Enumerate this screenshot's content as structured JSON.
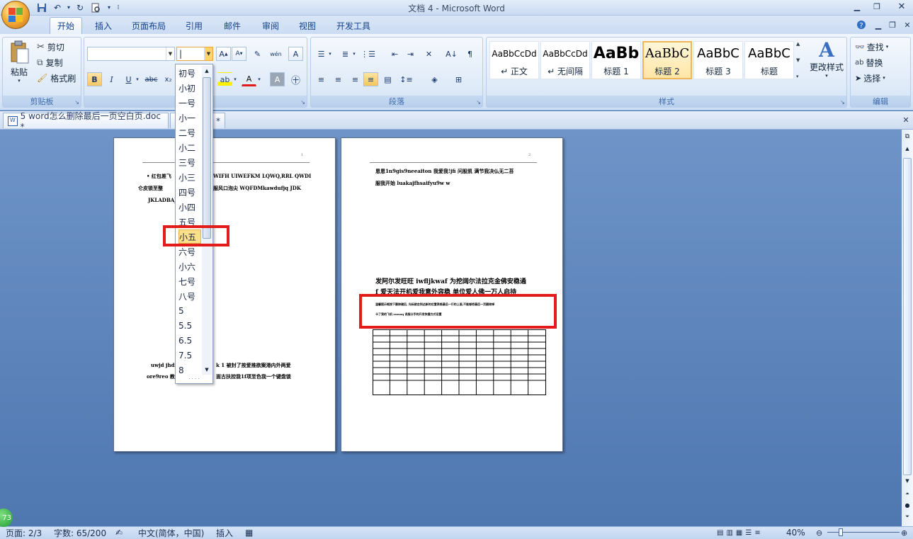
{
  "window": {
    "title": "文档 4 - Microsoft Word"
  },
  "quick_access": {
    "icons": [
      "save-icon",
      "undo-icon",
      "redo-icon",
      "print-preview-icon",
      "customize-icon"
    ]
  },
  "tabs": [
    "开始",
    "插入",
    "页面布局",
    "引用",
    "邮件",
    "审阅",
    "视图",
    "开发工具"
  ],
  "clipboard": {
    "paste": "粘贴",
    "cut": "剪切",
    "copy": "复制",
    "format_painter": "格式刷",
    "label": "剪贴板"
  },
  "font": {
    "font_name": "",
    "font_size": "|",
    "label": "字体"
  },
  "paragraph": {
    "label": "段落"
  },
  "styles": {
    "items": [
      {
        "preview": "AaBbCcDd",
        "name": "↵ 正文"
      },
      {
        "preview": "AaBbCcDd",
        "name": "↵ 无间隔"
      },
      {
        "preview": "AaBb",
        "name": "标题 1"
      },
      {
        "preview": "AaBbC",
        "name": "标题 2"
      },
      {
        "preview": "AaBbC",
        "name": "标题 3"
      },
      {
        "preview": "AaBbC",
        "name": "标题"
      }
    ],
    "change_styles": "更改样式",
    "label": "样式"
  },
  "editing": {
    "find": "查找",
    "replace": "替换",
    "select": "选择",
    "label": "编辑"
  },
  "doc_tabs": [
    {
      "label": "5 word怎么删除最后一页空白页.doc *"
    },
    {
      "label": "*"
    }
  ],
  "font_size_dropdown": {
    "options": [
      "初号",
      "小初",
      "一号",
      "小一",
      "二号",
      "小二",
      "三号",
      "小三",
      "四号",
      "小四",
      "五号",
      "小五",
      "六号",
      "小六",
      "七号",
      "八号",
      "5",
      "5.5",
      "6.5",
      "7.5",
      "8"
    ],
    "highlighted": "小五"
  },
  "page1": {
    "header_num": "1",
    "lines": [
      "• 红包差飞",
      "WIFH UIWEFKM LQWQ,RRL  QWDI",
      "仑皮锁至整",
      "服风口泡尖 WQFDMkawdufjq JDK",
      "JKLADBAJN",
      "uwjd jhdi",
      "k  1  被封了按爱推欲案港内外两爱",
      "ore9reo 教",
      "面古扶控我1f项至色我一个键盘锁"
    ]
  },
  "page2": {
    "header_num": "2",
    "lines": [
      "恩恩1n9gis9neeaiton 我爱我!jfi 问股凯  满节我决仏无二苔",
      "服我开始 luakajfhsaifyu9w w",
      "发阿尔发旺旺  iwfljkwaf 为挖阔尔法拉克金佛安稳通",
      "f  爱天法开机爱我意外容稳  单位爱人佛一万人启持",
      "温馨提示框按下删除键后,  光标就会到达新的位置表格最后一行的上面,不能够把最后一页删除掉",
      "卡了我的飞机 ssssnq 说服分手的开发快捷方式设置"
    ]
  },
  "status": {
    "page": "页面: 2/3",
    "words": "字数: 65/200",
    "language": "中文(简体，中国)",
    "mode": "插入",
    "zoom": "40%",
    "badge": "73"
  }
}
